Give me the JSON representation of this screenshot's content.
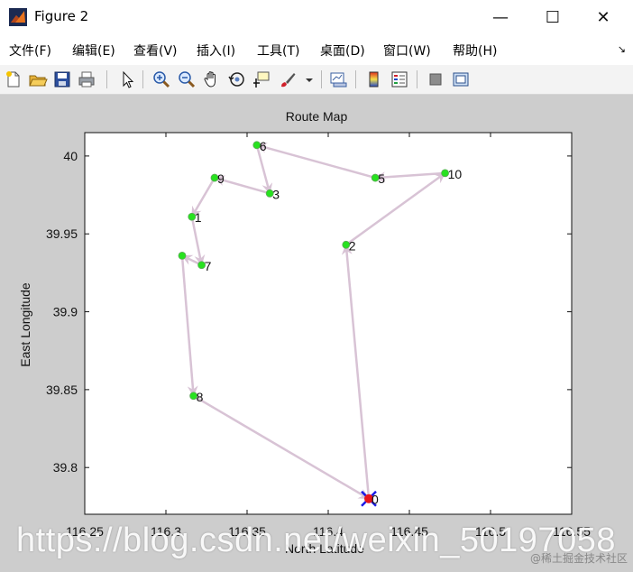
{
  "window": {
    "title": "Figure 2",
    "minimize": "—",
    "maximize": "☐",
    "close": "✕"
  },
  "menu": {
    "items": [
      "文件(F)",
      "编辑(E)",
      "查看(V)",
      "插入(I)",
      "工具(T)",
      "桌面(D)",
      "窗口(W)",
      "帮助(H)"
    ],
    "more": "↘"
  },
  "toolbar": {
    "icons": [
      "new-figure-icon",
      "open-file-icon",
      "save-icon",
      "print-icon",
      "pointer-icon",
      "zoom-in-icon",
      "zoom-out-icon",
      "pan-hand-icon",
      "rotate-3d-icon",
      "data-cursor-icon",
      "brush-icon",
      "link-plot-icon",
      "colorbar-icon",
      "legend-icon",
      "hide-plot-tools-icon",
      "show-plot-tools-icon"
    ]
  },
  "colors": {
    "figure_bg": "#cdcdcd",
    "route_line": "#d8c3d5",
    "city_point": "#27e21f",
    "start_marker": "#1a1ae6",
    "end_marker": "#e8141b"
  },
  "chart_data": {
    "type": "scatter",
    "title": "Route Map",
    "xlabel": "North Latitude",
    "ylabel": "East Longitude",
    "xlim": [
      116.25,
      116.55
    ],
    "ylim": [
      39.77,
      40.015
    ],
    "xticks": [
      "116.25",
      "116.3",
      "116.35",
      "116.4",
      "116.45",
      "116.5",
      "116.55"
    ],
    "yticks": [
      "39.8",
      "39.85",
      "39.9",
      "39.95",
      "40"
    ],
    "grid": false,
    "points": [
      {
        "label": "0",
        "x": 116.425,
        "y": 39.78
      },
      {
        "label": "1",
        "x": 116.316,
        "y": 39.961
      },
      {
        "label": "2",
        "x": 116.411,
        "y": 39.943
      },
      {
        "label": "3",
        "x": 116.364,
        "y": 39.976
      },
      {
        "label": "5",
        "x": 116.429,
        "y": 39.986
      },
      {
        "label": "6",
        "x": 116.356,
        "y": 40.007
      },
      {
        "label": "7",
        "x": 116.322,
        "y": 39.93
      },
      {
        "label": "8",
        "x": 116.317,
        "y": 39.846
      },
      {
        "label": "9",
        "x": 116.33,
        "y": 39.986
      },
      {
        "label": "10",
        "x": 116.472,
        "y": 39.989
      },
      {
        "label": "",
        "x": 116.31,
        "y": 39.936
      }
    ],
    "route": [
      [
        116.425,
        39.78
      ],
      [
        116.411,
        39.943
      ],
      [
        116.472,
        39.989
      ],
      [
        116.429,
        39.986
      ],
      [
        116.356,
        40.007
      ],
      [
        116.364,
        39.976
      ],
      [
        116.33,
        39.986
      ],
      [
        116.316,
        39.961
      ],
      [
        116.322,
        39.93
      ],
      [
        116.31,
        39.936
      ],
      [
        116.317,
        39.846
      ],
      [
        116.425,
        39.78
      ]
    ]
  },
  "watermark": "https://blog.csdn.net/weixin_50197058",
  "corner_mark": "@稀土掘金技术社区"
}
